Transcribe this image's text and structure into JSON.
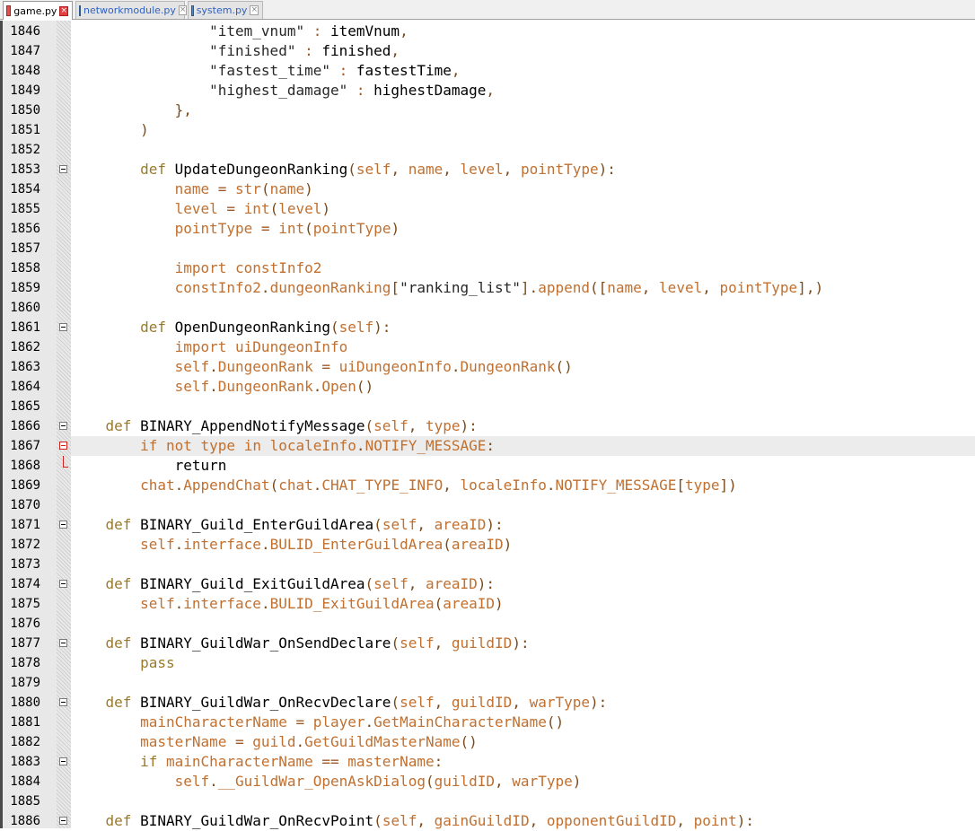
{
  "tabs": [
    {
      "label": "game.py",
      "icon": "python-file-icon-red",
      "active": true
    },
    {
      "label": "networkmodule.py",
      "icon": "python-file-icon-blue",
      "active": false
    },
    {
      "label": "system.py",
      "icon": "python-file-icon-blue",
      "active": false
    }
  ],
  "colors": {
    "keyword": "#9a7a2a",
    "identifier": "#000000",
    "self_builtin": "#c07030",
    "punctuation": "#7a4a1a",
    "string": "#282828",
    "current_line": "#ececec",
    "line_number_bg": "#e8e8e8"
  },
  "editor": {
    "current_line": 1867,
    "lines": [
      {
        "num": "1846",
        "fold": "",
        "segments": [
          [
            "ws",
            "                "
          ],
          [
            "str",
            "\"item_vnum\""
          ],
          [
            "op",
            " : "
          ],
          [
            "n",
            "itemVnum"
          ],
          [
            "p",
            ","
          ]
        ]
      },
      {
        "num": "1847",
        "fold": "",
        "segments": [
          [
            "ws",
            "                "
          ],
          [
            "str",
            "\"finished\""
          ],
          [
            "op",
            " : "
          ],
          [
            "n",
            "finished"
          ],
          [
            "p",
            ","
          ]
        ]
      },
      {
        "num": "1848",
        "fold": "",
        "segments": [
          [
            "ws",
            "                "
          ],
          [
            "str",
            "\"fastest_time\""
          ],
          [
            "op",
            " : "
          ],
          [
            "n",
            "fastestTime"
          ],
          [
            "p",
            ","
          ]
        ]
      },
      {
        "num": "1849",
        "fold": "",
        "segments": [
          [
            "ws",
            "                "
          ],
          [
            "str",
            "\"highest_damage\""
          ],
          [
            "op",
            " : "
          ],
          [
            "n",
            "highestDamage"
          ],
          [
            "p",
            ","
          ]
        ]
      },
      {
        "num": "1850",
        "fold": "",
        "segments": [
          [
            "ws",
            "            "
          ],
          [
            "p",
            "},"
          ]
        ]
      },
      {
        "num": "1851",
        "fold": "",
        "segments": [
          [
            "ws",
            "        "
          ],
          [
            "p",
            ")"
          ]
        ]
      },
      {
        "num": "1852",
        "fold": "",
        "segments": []
      },
      {
        "num": "1853",
        "fold": "box",
        "segments": [
          [
            "ws",
            "        "
          ],
          [
            "kw",
            "def"
          ],
          [
            "ws",
            " "
          ],
          [
            "n",
            "UpdateDungeonRanking"
          ],
          [
            "p",
            "("
          ],
          [
            "sb",
            "self"
          ],
          [
            "p",
            ", "
          ],
          [
            "sb",
            "name"
          ],
          [
            "p",
            ", "
          ],
          [
            "sb",
            "level"
          ],
          [
            "p",
            ", "
          ],
          [
            "sb",
            "pointType"
          ],
          [
            "p",
            "):"
          ]
        ]
      },
      {
        "num": "1854",
        "fold": "",
        "segments": [
          [
            "ws",
            "            "
          ],
          [
            "sb",
            "name"
          ],
          [
            "op",
            " = "
          ],
          [
            "sb",
            "str"
          ],
          [
            "p",
            "("
          ],
          [
            "sb",
            "name"
          ],
          [
            "p",
            ")"
          ]
        ]
      },
      {
        "num": "1855",
        "fold": "",
        "segments": [
          [
            "ws",
            "            "
          ],
          [
            "sb",
            "level"
          ],
          [
            "op",
            " = "
          ],
          [
            "sb",
            "int"
          ],
          [
            "p",
            "("
          ],
          [
            "sb",
            "level"
          ],
          [
            "p",
            ")"
          ]
        ]
      },
      {
        "num": "1856",
        "fold": "",
        "segments": [
          [
            "ws",
            "            "
          ],
          [
            "sb",
            "pointType"
          ],
          [
            "op",
            " = "
          ],
          [
            "sb",
            "int"
          ],
          [
            "p",
            "("
          ],
          [
            "sb",
            "pointType"
          ],
          [
            "p",
            ")"
          ]
        ]
      },
      {
        "num": "1857",
        "fold": "",
        "segments": []
      },
      {
        "num": "1858",
        "fold": "",
        "segments": [
          [
            "ws",
            "            "
          ],
          [
            "sb",
            "import"
          ],
          [
            "ws",
            " "
          ],
          [
            "sb",
            "constInfo2"
          ]
        ]
      },
      {
        "num": "1859",
        "fold": "",
        "segments": [
          [
            "ws",
            "            "
          ],
          [
            "sb",
            "constInfo2"
          ],
          [
            "p",
            "."
          ],
          [
            "sb",
            "dungeonRanking"
          ],
          [
            "p",
            "["
          ],
          [
            "str",
            "\"ranking_list\""
          ],
          [
            "p",
            "]."
          ],
          [
            "sb",
            "append"
          ],
          [
            "p",
            "(["
          ],
          [
            "sb",
            "name"
          ],
          [
            "p",
            ", "
          ],
          [
            "sb",
            "level"
          ],
          [
            "p",
            ", "
          ],
          [
            "sb",
            "pointType"
          ],
          [
            "p",
            "],)"
          ]
        ]
      },
      {
        "num": "1860",
        "fold": "",
        "segments": []
      },
      {
        "num": "1861",
        "fold": "box",
        "segments": [
          [
            "ws",
            "        "
          ],
          [
            "kw",
            "def"
          ],
          [
            "ws",
            " "
          ],
          [
            "n",
            "OpenDungeonRanking"
          ],
          [
            "p",
            "("
          ],
          [
            "sb",
            "self"
          ],
          [
            "p",
            "):"
          ]
        ]
      },
      {
        "num": "1862",
        "fold": "",
        "segments": [
          [
            "ws",
            "            "
          ],
          [
            "sb",
            "import"
          ],
          [
            "ws",
            " "
          ],
          [
            "sb",
            "uiDungeonInfo"
          ]
        ]
      },
      {
        "num": "1863",
        "fold": "",
        "segments": [
          [
            "ws",
            "            "
          ],
          [
            "sb",
            "self"
          ],
          [
            "p",
            "."
          ],
          [
            "sb",
            "DungeonRank"
          ],
          [
            "op",
            " = "
          ],
          [
            "sb",
            "uiDungeonInfo"
          ],
          [
            "p",
            "."
          ],
          [
            "sb",
            "DungeonRank"
          ],
          [
            "p",
            "()"
          ]
        ]
      },
      {
        "num": "1864",
        "fold": "",
        "segments": [
          [
            "ws",
            "            "
          ],
          [
            "sb",
            "self"
          ],
          [
            "p",
            "."
          ],
          [
            "sb",
            "DungeonRank"
          ],
          [
            "p",
            "."
          ],
          [
            "sb",
            "Open"
          ],
          [
            "p",
            "()"
          ]
        ]
      },
      {
        "num": "1865",
        "fold": "",
        "segments": []
      },
      {
        "num": "1866",
        "fold": "box",
        "segments": [
          [
            "ws",
            "    "
          ],
          [
            "kw",
            "def"
          ],
          [
            "ws",
            " "
          ],
          [
            "n",
            "BINARY_AppendNotifyMessage"
          ],
          [
            "p",
            "("
          ],
          [
            "sb",
            "self"
          ],
          [
            "p",
            ", "
          ],
          [
            "sb",
            "type"
          ],
          [
            "p",
            "):"
          ]
        ]
      },
      {
        "num": "1867",
        "fold": "box-red",
        "segments": [
          [
            "ws",
            "        "
          ],
          [
            "sb",
            "if"
          ],
          [
            "ws",
            " "
          ],
          [
            "sb",
            "not"
          ],
          [
            "ws",
            " "
          ],
          [
            "sb",
            "type"
          ],
          [
            "ws",
            " "
          ],
          [
            "sb",
            "in"
          ],
          [
            "ws",
            " "
          ],
          [
            "sb",
            "localeInfo"
          ],
          [
            "p",
            "."
          ],
          [
            "sb",
            "NOTIFY_MESSAGE"
          ],
          [
            "p",
            ":"
          ]
        ]
      },
      {
        "num": "1868",
        "fold": "end-red",
        "segments": [
          [
            "ws",
            "            "
          ],
          [
            "n",
            "return"
          ]
        ]
      },
      {
        "num": "1869",
        "fold": "",
        "segments": [
          [
            "ws",
            "        "
          ],
          [
            "sb",
            "chat"
          ],
          [
            "p",
            "."
          ],
          [
            "sb",
            "AppendChat"
          ],
          [
            "p",
            "("
          ],
          [
            "sb",
            "chat"
          ],
          [
            "p",
            "."
          ],
          [
            "sb",
            "CHAT_TYPE_INFO"
          ],
          [
            "p",
            ", "
          ],
          [
            "sb",
            "localeInfo"
          ],
          [
            "p",
            "."
          ],
          [
            "sb",
            "NOTIFY_MESSAGE"
          ],
          [
            "p",
            "["
          ],
          [
            "sb",
            "type"
          ],
          [
            "p",
            "])"
          ]
        ]
      },
      {
        "num": "1870",
        "fold": "",
        "segments": []
      },
      {
        "num": "1871",
        "fold": "box",
        "segments": [
          [
            "ws",
            "    "
          ],
          [
            "kw",
            "def"
          ],
          [
            "ws",
            " "
          ],
          [
            "n",
            "BINARY_Guild_EnterGuildArea"
          ],
          [
            "p",
            "("
          ],
          [
            "sb",
            "self"
          ],
          [
            "p",
            ", "
          ],
          [
            "sb",
            "areaID"
          ],
          [
            "p",
            "):"
          ]
        ]
      },
      {
        "num": "1872",
        "fold": "",
        "segments": [
          [
            "ws",
            "        "
          ],
          [
            "sb",
            "self"
          ],
          [
            "p",
            "."
          ],
          [
            "sb",
            "interface"
          ],
          [
            "p",
            "."
          ],
          [
            "sb",
            "BULID_EnterGuildArea"
          ],
          [
            "p",
            "("
          ],
          [
            "sb",
            "areaID"
          ],
          [
            "p",
            ")"
          ]
        ]
      },
      {
        "num": "1873",
        "fold": "",
        "segments": []
      },
      {
        "num": "1874",
        "fold": "box",
        "segments": [
          [
            "ws",
            "    "
          ],
          [
            "kw",
            "def"
          ],
          [
            "ws",
            " "
          ],
          [
            "n",
            "BINARY_Guild_ExitGuildArea"
          ],
          [
            "p",
            "("
          ],
          [
            "sb",
            "self"
          ],
          [
            "p",
            ", "
          ],
          [
            "sb",
            "areaID"
          ],
          [
            "p",
            "):"
          ]
        ]
      },
      {
        "num": "1875",
        "fold": "",
        "segments": [
          [
            "ws",
            "        "
          ],
          [
            "sb",
            "self"
          ],
          [
            "p",
            "."
          ],
          [
            "sb",
            "interface"
          ],
          [
            "p",
            "."
          ],
          [
            "sb",
            "BULID_ExitGuildArea"
          ],
          [
            "p",
            "("
          ],
          [
            "sb",
            "areaID"
          ],
          [
            "p",
            ")"
          ]
        ]
      },
      {
        "num": "1876",
        "fold": "",
        "segments": []
      },
      {
        "num": "1877",
        "fold": "box",
        "segments": [
          [
            "ws",
            "    "
          ],
          [
            "kw",
            "def"
          ],
          [
            "ws",
            " "
          ],
          [
            "n",
            "BINARY_GuildWar_OnSendDeclare"
          ],
          [
            "p",
            "("
          ],
          [
            "sb",
            "self"
          ],
          [
            "p",
            ", "
          ],
          [
            "sb",
            "guildID"
          ],
          [
            "p",
            "):"
          ]
        ]
      },
      {
        "num": "1878",
        "fold": "",
        "segments": [
          [
            "ws",
            "        "
          ],
          [
            "kw",
            "pass"
          ]
        ]
      },
      {
        "num": "1879",
        "fold": "",
        "segments": []
      },
      {
        "num": "1880",
        "fold": "box",
        "segments": [
          [
            "ws",
            "    "
          ],
          [
            "kw",
            "def"
          ],
          [
            "ws",
            " "
          ],
          [
            "n",
            "BINARY_GuildWar_OnRecvDeclare"
          ],
          [
            "p",
            "("
          ],
          [
            "sb",
            "self"
          ],
          [
            "p",
            ", "
          ],
          [
            "sb",
            "guildID"
          ],
          [
            "p",
            ", "
          ],
          [
            "sb",
            "warType"
          ],
          [
            "p",
            "):"
          ]
        ]
      },
      {
        "num": "1881",
        "fold": "",
        "segments": [
          [
            "ws",
            "        "
          ],
          [
            "sb",
            "mainCharacterName"
          ],
          [
            "op",
            " = "
          ],
          [
            "sb",
            "player"
          ],
          [
            "p",
            "."
          ],
          [
            "sb",
            "GetMainCharacterName"
          ],
          [
            "p",
            "()"
          ]
        ]
      },
      {
        "num": "1882",
        "fold": "",
        "segments": [
          [
            "ws",
            "        "
          ],
          [
            "sb",
            "masterName"
          ],
          [
            "op",
            " = "
          ],
          [
            "sb",
            "guild"
          ],
          [
            "p",
            "."
          ],
          [
            "sb",
            "GetGuildMasterName"
          ],
          [
            "p",
            "()"
          ]
        ]
      },
      {
        "num": "1883",
        "fold": "box",
        "segments": [
          [
            "ws",
            "        "
          ],
          [
            "kw",
            "if"
          ],
          [
            "ws",
            " "
          ],
          [
            "sb",
            "mainCharacterName"
          ],
          [
            "op",
            " == "
          ],
          [
            "sb",
            "masterName"
          ],
          [
            "p",
            ":"
          ]
        ]
      },
      {
        "num": "1884",
        "fold": "",
        "segments": [
          [
            "ws",
            "            "
          ],
          [
            "sb",
            "self"
          ],
          [
            "p",
            "."
          ],
          [
            "sb",
            "__GuildWar_OpenAskDialog"
          ],
          [
            "p",
            "("
          ],
          [
            "sb",
            "guildID"
          ],
          [
            "p",
            ", "
          ],
          [
            "sb",
            "warType"
          ],
          [
            "p",
            ")"
          ]
        ]
      },
      {
        "num": "1885",
        "fold": "",
        "segments": []
      },
      {
        "num": "1886",
        "fold": "box",
        "segments": [
          [
            "ws",
            "    "
          ],
          [
            "kw",
            "def"
          ],
          [
            "ws",
            " "
          ],
          [
            "n",
            "BINARY_GuildWar_OnRecvPoint"
          ],
          [
            "p",
            "("
          ],
          [
            "sb",
            "self"
          ],
          [
            "p",
            ", "
          ],
          [
            "sb",
            "gainGuildID"
          ],
          [
            "p",
            ", "
          ],
          [
            "sb",
            "opponentGuildID"
          ],
          [
            "p",
            ", "
          ],
          [
            "sb",
            "point"
          ],
          [
            "p",
            "):"
          ]
        ]
      }
    ]
  }
}
